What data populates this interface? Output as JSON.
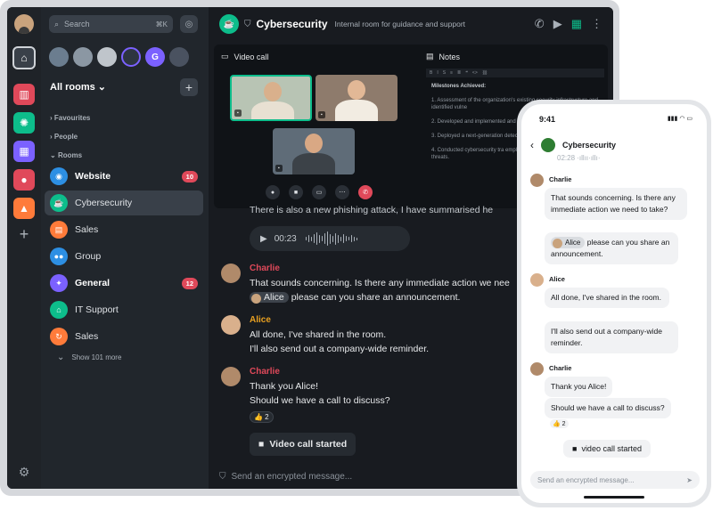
{
  "desktop": {
    "search": {
      "label": "Search",
      "shortcut": "⌘K"
    },
    "room_list": {
      "title": "All rooms",
      "sections": {
        "favourites": "Favourites",
        "people": "People",
        "rooms": "Rooms"
      },
      "rooms": [
        {
          "label": "Website",
          "badge": "10",
          "bold": true,
          "color": "#2d8fe3",
          "icon": "globe-icon"
        },
        {
          "label": "Cybersecurity",
          "badge": "",
          "bold": false,
          "color": "#0dbd8b",
          "icon": "coffee-icon"
        },
        {
          "label": "Sales",
          "badge": "",
          "bold": false,
          "color": "#ff7b3a",
          "icon": "chart-icon"
        },
        {
          "label": "Group",
          "badge": "",
          "bold": false,
          "color": "#2d8fe3",
          "icon": "people-icon"
        },
        {
          "label": "General",
          "badge": "12",
          "bold": true,
          "color": "#7b61ff",
          "icon": "megaphone-icon"
        },
        {
          "label": "IT Support",
          "badge": "",
          "bold": false,
          "color": "#0dbd8b",
          "icon": "house-icon"
        },
        {
          "label": "Sales",
          "badge": "",
          "bold": false,
          "color": "#ff7b3a",
          "icon": "refresh-icon"
        }
      ],
      "show_more": "Show 101 more"
    },
    "header": {
      "room_name": "Cybersecurity",
      "topic": "Internal room for guidance and support"
    },
    "widgets": {
      "video_call_title": "Video call",
      "notes_title": "Notes",
      "notes_heading": "Milestones Achieved:",
      "notes_items": [
        "1. Assessment of the organization's existing security infrastructure and identified vulne",
        "2. Developed and implemented and procedures, aligning them",
        "3. Deployed a next-generation detection system to fortify our",
        "4. Conducted cybersecurity tra employees, focusing on recogn security threats."
      ],
      "toolbar_glyphs": [
        "B",
        "I",
        "S",
        "≡",
        "≣",
        "❝",
        "<>",
        "⛓"
      ]
    },
    "timeline": {
      "cut_line": "There is also a new phishing attack, I have summarised he",
      "voice_duration": "00:23",
      "messages": [
        {
          "sender": "Charlie",
          "color": "#e0495a",
          "lines": [
            "That sounds concerning. Is there any immediate action we nee"
          ],
          "mention": "Alice",
          "mention_text": "please can you share an announcement."
        },
        {
          "sender": "Alice",
          "color": "#e8a020",
          "lines": [
            "All done, I've shared in the room.",
            "I'll also send out a company-wide reminder."
          ]
        },
        {
          "sender": "Charlie",
          "color": "#e0495a",
          "lines": [
            "Thank you Alice!",
            "Should we have a call to discuss?"
          ],
          "reaction": "👍 2"
        }
      ],
      "video_started": "Video call started"
    },
    "composer_placeholder": "Send an encrypted message..."
  },
  "phone": {
    "time": "9:41",
    "room_name": "Cybersecurity",
    "cut_voice": "02:28",
    "messages": [
      {
        "sender": "Charlie",
        "text": "That sounds concerning. Is there any immediate action we need to take?",
        "mention": "Alice",
        "mention_text": "please can you share an announcement."
      },
      {
        "sender": "Alice",
        "text1": "All done, I've shared in the room.",
        "text2": "I'll also send out a company-wide reminder."
      },
      {
        "sender": "Charlie",
        "text1": "Thank you Alice!",
        "text2": "Should we have a call to discuss?",
        "reaction": "👍 2"
      }
    ],
    "video_started": "video call started",
    "composer_placeholder": "Send an encrypted message..."
  }
}
